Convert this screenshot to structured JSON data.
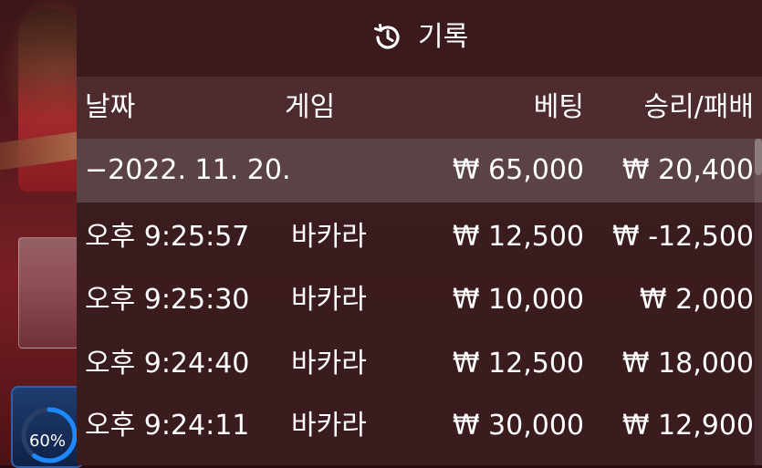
{
  "progress": {
    "label": "60%",
    "value": 0.6,
    "color": "#1e88ff"
  },
  "panel": {
    "title": "기록",
    "icon": "history-icon"
  },
  "columns": {
    "date": "날짜",
    "game": "게임",
    "bet": "베팅",
    "result": "승리/패배"
  },
  "summary": {
    "date": "−2022. 11. 20.",
    "bet": "₩ 65,000",
    "result": "₩ 20,400"
  },
  "rows": [
    {
      "time": "오후 9:25:57",
      "game": "바카라",
      "bet": "₩ 12,500",
      "result": "₩ -12,500"
    },
    {
      "time": "오후 9:25:30",
      "game": "바카라",
      "bet": "₩ 10,000",
      "result": "₩ 2,000"
    },
    {
      "time": "오후 9:24:40",
      "game": "바카라",
      "bet": "₩ 12,500",
      "result": "₩ 18,000"
    },
    {
      "time": "오후 9:24:11",
      "game": "바카라",
      "bet": "₩ 30,000",
      "result": "₩ 12,900"
    }
  ]
}
